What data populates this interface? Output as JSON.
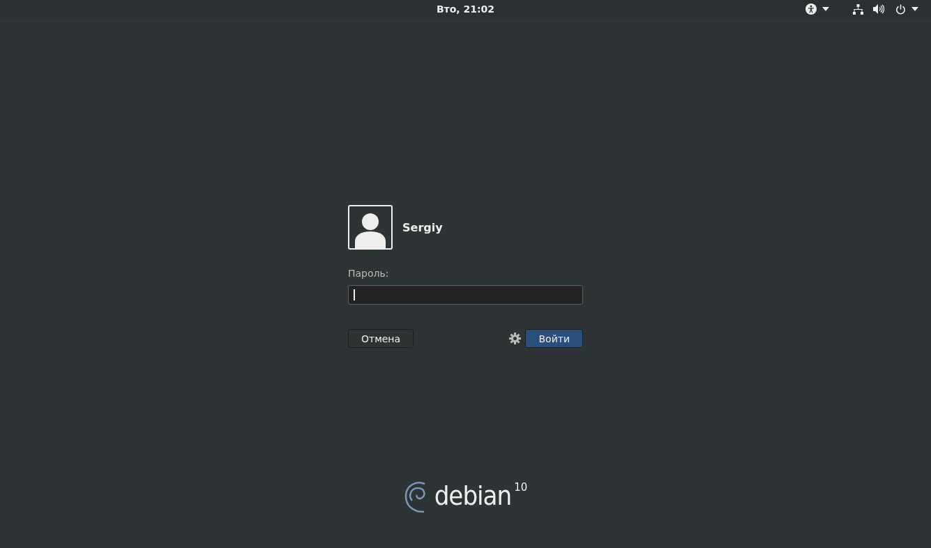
{
  "top_bar": {
    "clock": "Вто, 21:02"
  },
  "login": {
    "user_name": "Sergiy",
    "password_label": "Пароль:",
    "buttons": [
      {
        "label": "Отмена",
        "kind": "normal"
      },
      {
        "label": "Войти",
        "kind": "suggested"
      }
    ]
  },
  "logo": {
    "name": "debian",
    "version": "10"
  }
}
